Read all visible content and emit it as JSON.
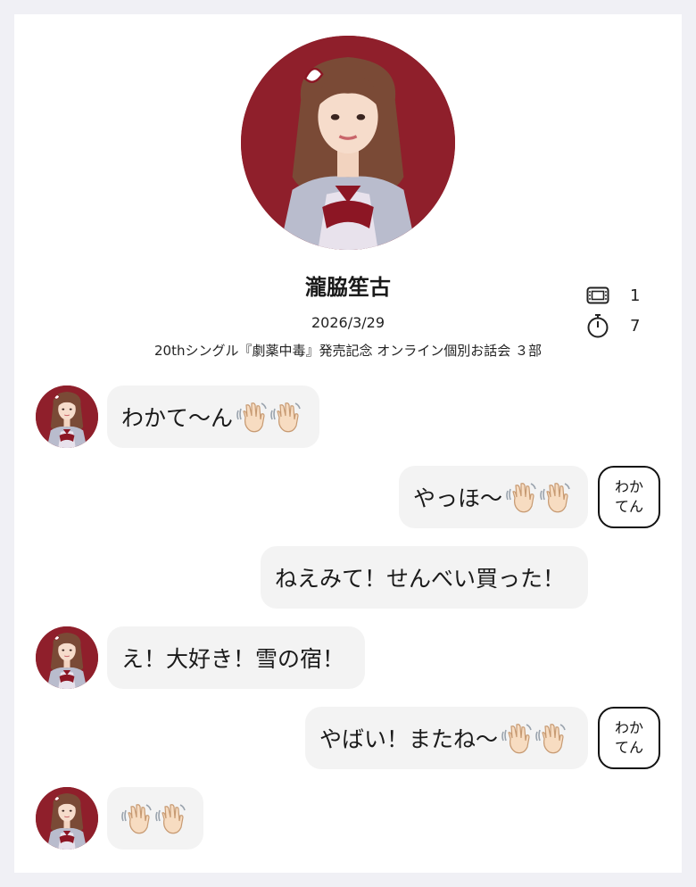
{
  "header": {
    "member_name": "瀧脇笙古",
    "date": "2026/3/29",
    "event_title": "20thシングル『劇薬中毒』発売記念 オンライン個別お話会 ３部",
    "stats": [
      {
        "icon": "ticket-icon",
        "value": "1"
      },
      {
        "icon": "stopwatch-icon",
        "value": "7"
      }
    ]
  },
  "chat": {
    "messages": [
      {
        "sender": "member",
        "text": "わかて〜ん",
        "emoji": "👋🏻👋🏻"
      },
      {
        "sender": "fan",
        "text": "やっほ〜",
        "emoji": "👋🏻👋🏻",
        "badge": [
          "わか",
          "てん"
        ]
      },
      {
        "sender": "fan",
        "text": "ねえみて！せんべい買った！",
        "emoji": ""
      },
      {
        "sender": "member",
        "text": "え！大好き！雪の宿！",
        "emoji": ""
      },
      {
        "sender": "fan",
        "text": "やばい！またね〜",
        "emoji": "👋🏻👋🏻",
        "badge": [
          "わか",
          "てん"
        ]
      },
      {
        "sender": "member",
        "text": "",
        "emoji": "👋🏻👋🏻"
      }
    ]
  },
  "colors": {
    "background": "#f0f0f5",
    "card": "#ffffff",
    "bubble": "#f3f3f3",
    "photo_backdrop": "#8f1f2b"
  }
}
